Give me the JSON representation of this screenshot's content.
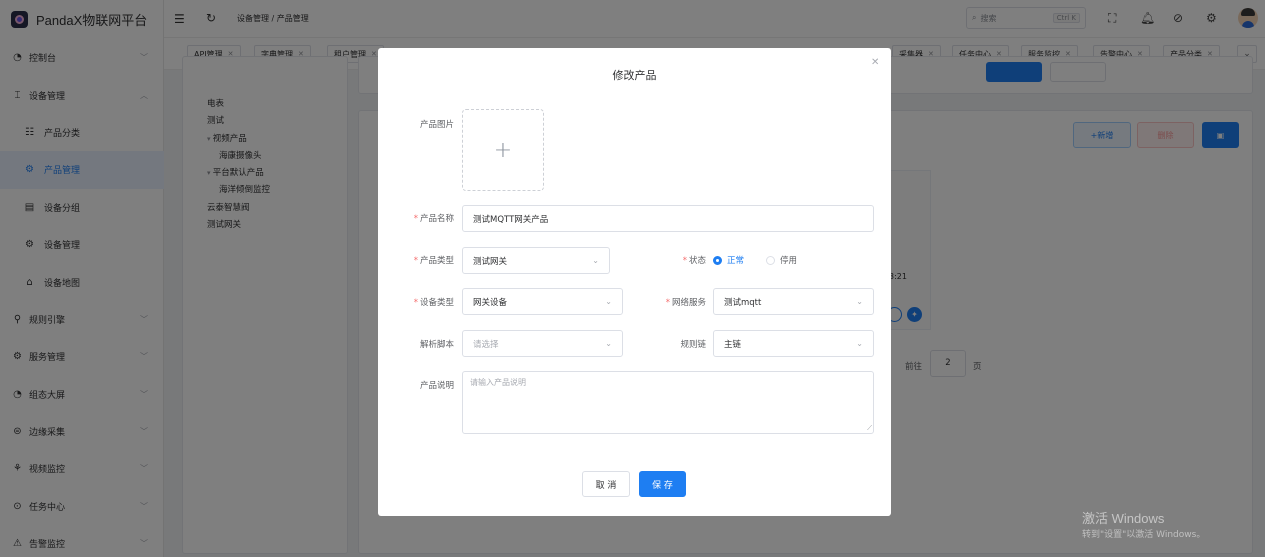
{
  "app": {
    "title": "PandaX物联网平台"
  },
  "sidebar": {
    "items": [
      {
        "label": "控制台",
        "icon": "dashboard-icon",
        "glyph": "◔"
      },
      {
        "label": "设备管理",
        "icon": "device-management-icon",
        "glyph": "⌶",
        "expanded": true
      },
      {
        "label": "产品分类",
        "icon": "category-icon",
        "glyph": "☷",
        "sub": true
      },
      {
        "label": "产品管理",
        "icon": "product-icon",
        "glyph": "⚙",
        "sub": true,
        "active": true
      },
      {
        "label": "设备分组",
        "icon": "group-icon",
        "glyph": "▤",
        "sub": true
      },
      {
        "label": "设备管理",
        "icon": "settings-icon",
        "glyph": "⚙",
        "sub": true
      },
      {
        "label": "设备地图",
        "icon": "map-icon",
        "glyph": "⌂",
        "sub": true
      },
      {
        "label": "规则引擎",
        "icon": "rules-icon",
        "glyph": "⚲"
      },
      {
        "label": "服务管理",
        "icon": "service-icon",
        "glyph": "⚙"
      },
      {
        "label": "组态大屏",
        "icon": "screen-icon",
        "glyph": "◔"
      },
      {
        "label": "边缘采集",
        "icon": "edge-icon",
        "glyph": "⊜"
      },
      {
        "label": "视频监控",
        "icon": "video-icon",
        "glyph": "⚘"
      },
      {
        "label": "任务中心",
        "icon": "task-icon",
        "glyph": "⊙"
      },
      {
        "label": "告警监控",
        "icon": "alarm-icon",
        "glyph": "⚠"
      }
    ]
  },
  "header": {
    "breadcrumb": "设备管理 / 产品管理",
    "search_placeholder": "搜索",
    "search_shortcut": "Ctrl K"
  },
  "tags": [
    {
      "label": "API管理"
    },
    {
      "label": "字典管理"
    },
    {
      "label": "租户管理"
    },
    {
      "label": "采集器"
    },
    {
      "label": "任务中心"
    },
    {
      "label": "服务监控"
    },
    {
      "label": "告警中心"
    },
    {
      "label": "产品分类"
    }
  ],
  "tree": {
    "nodes": [
      "电表",
      "测试",
      "视频产品",
      "海康摄像头",
      "平台默认产品",
      "海洋倾倒监控",
      "云泰智慧阀",
      "测试网关"
    ]
  },
  "background": {
    "add_button": "+新增",
    "delete_button": "删除",
    "time_fragment": "3:21",
    "goto_label": "前往",
    "page_value": "2",
    "page_suffix": "页"
  },
  "dialog": {
    "title": "修改产品",
    "image_label": "产品图片",
    "name_label": "产品名称",
    "name_value": "测试MQTT网关产品",
    "type_label": "产品类型",
    "type_value": "测试网关",
    "status_label": "状态",
    "status_options": [
      "正常",
      "停用"
    ],
    "status_selected": "正常",
    "device_type_label": "设备类型",
    "device_type_value": "网关设备",
    "network_label": "网络服务",
    "network_value": "测试mqtt",
    "script_label": "解析脚本",
    "script_placeholder": "请选择",
    "rule_label": "规则链",
    "rule_value": "主链",
    "desc_label": "产品说明",
    "desc_placeholder": "请输入产品说明",
    "cancel_label": "取 消",
    "save_label": "保 存"
  },
  "watermark": {
    "line1": "激活 Windows",
    "line2": "转到\"设置\"以激活 Windows。"
  },
  "colors": {
    "primary": "#1e7ef2",
    "required": "#f56c6c",
    "mask": "rgba(0,0,0,0.5)"
  }
}
